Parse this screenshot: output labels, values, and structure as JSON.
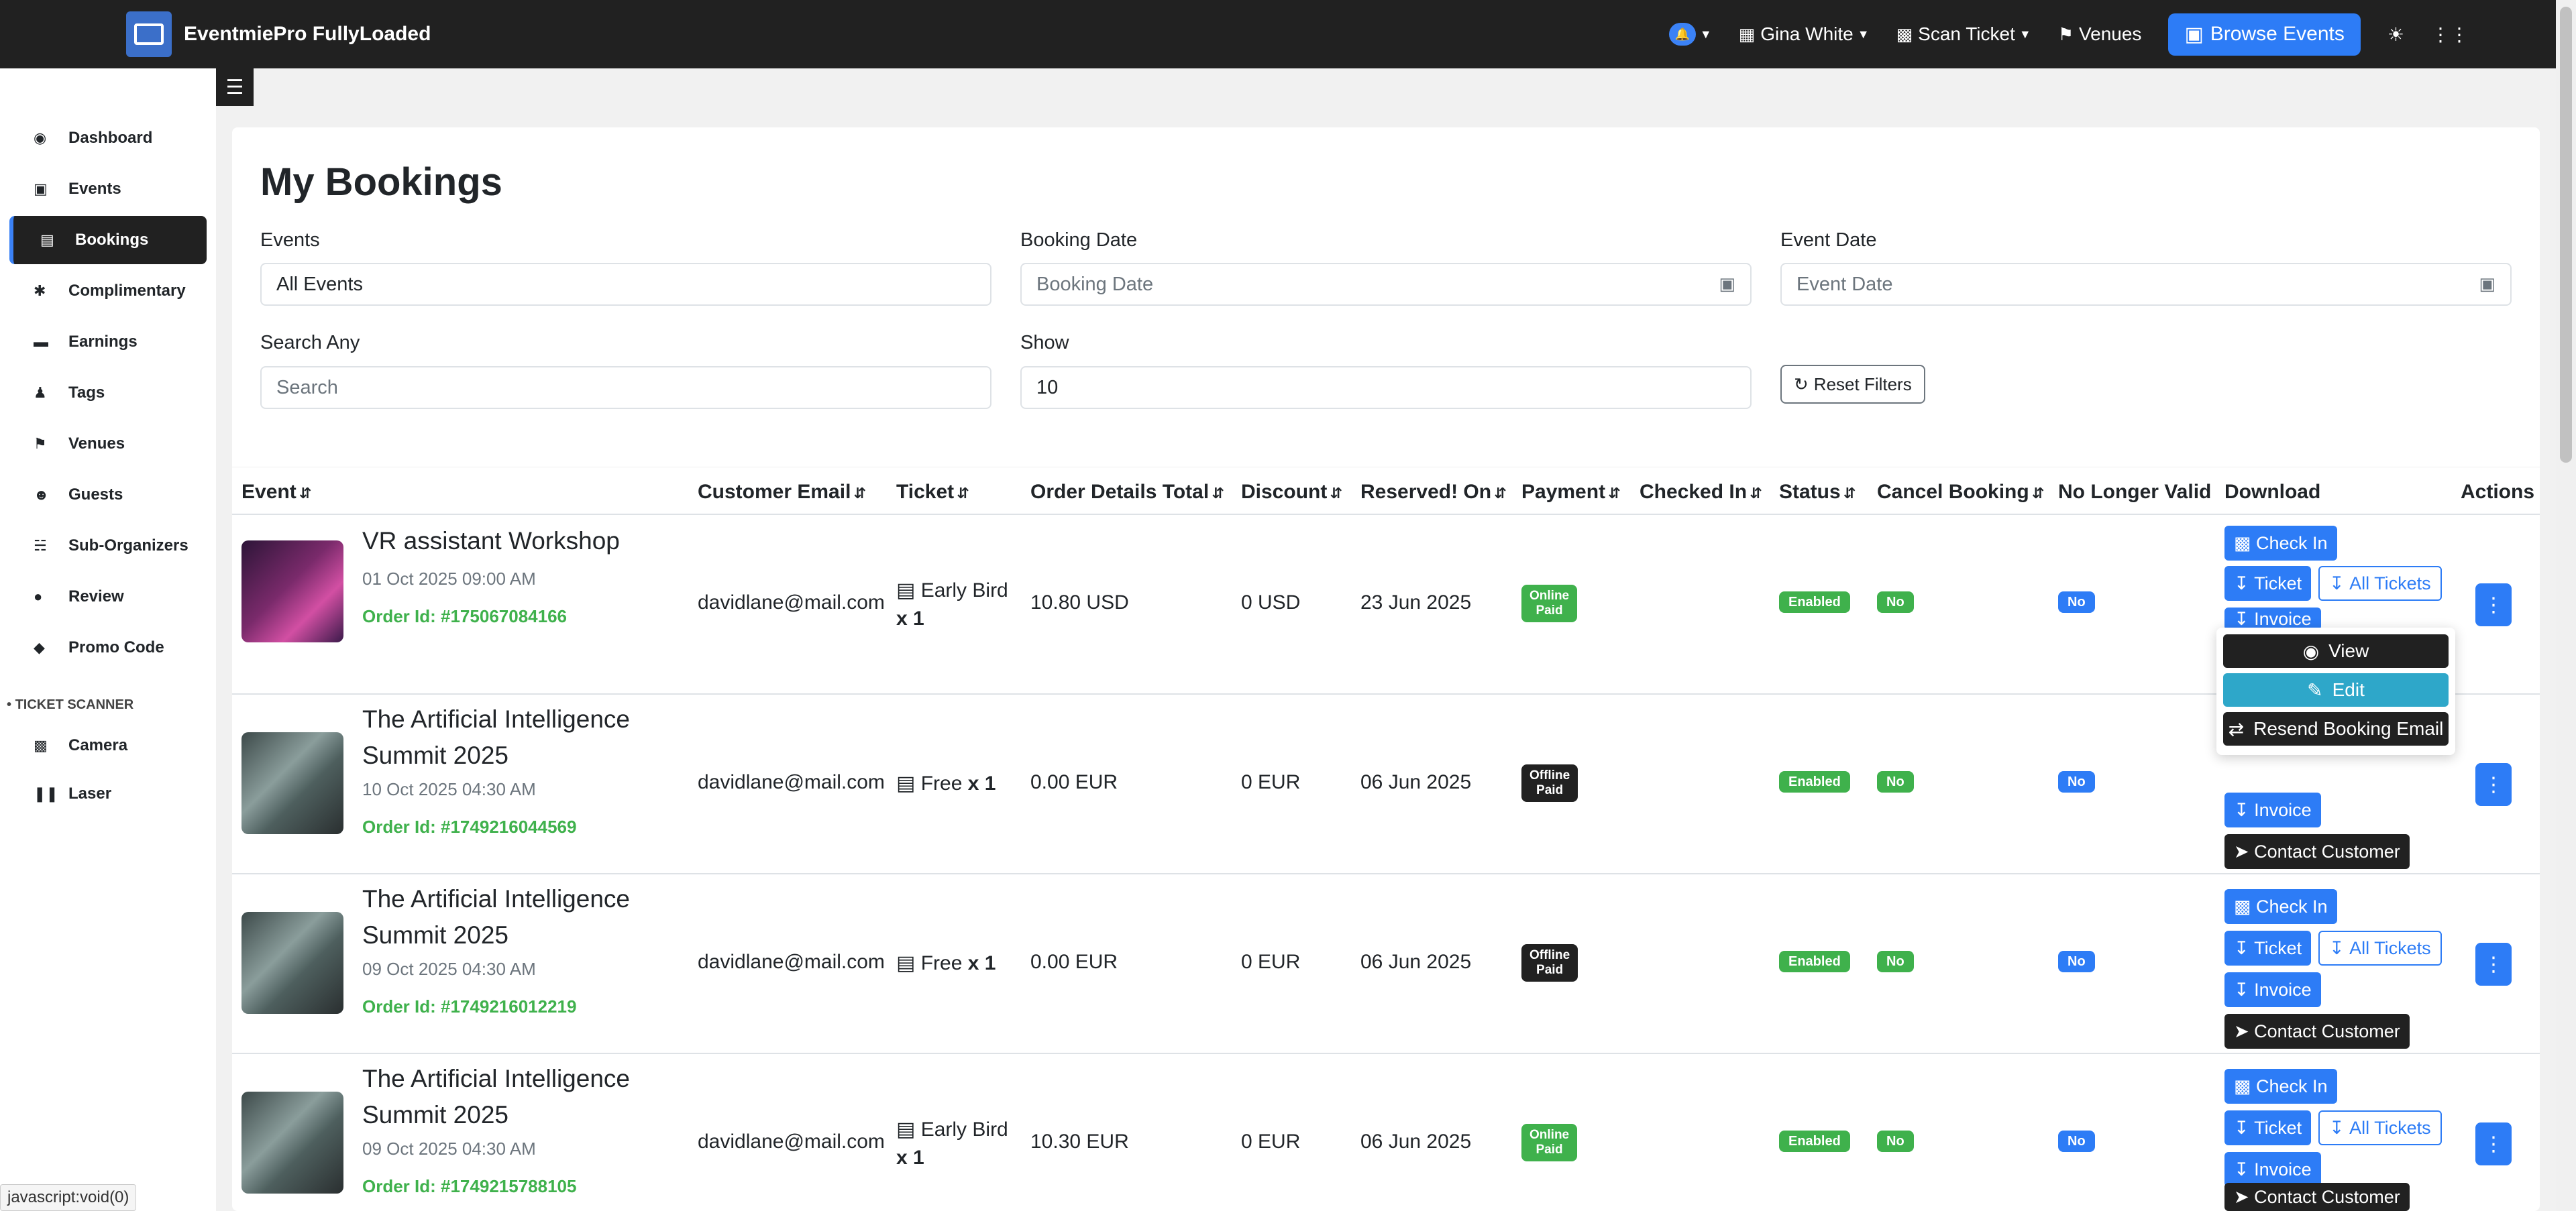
{
  "app": {
    "title": "EventmiePro FullyLoaded"
  },
  "topbar": {
    "user": "Gina White",
    "scan_ticket": "Scan Ticket",
    "venues": "Venues",
    "browse_events": "Browse Events"
  },
  "sidebar": {
    "items": [
      {
        "label": "Dashboard",
        "icon": "dashboard-icon"
      },
      {
        "label": "Events",
        "icon": "calendar-icon"
      },
      {
        "label": "Bookings",
        "icon": "ticket-icon",
        "active": true
      },
      {
        "label": "Complimentary",
        "icon": "puzzle-icon"
      },
      {
        "label": "Earnings",
        "icon": "wallet-icon"
      },
      {
        "label": "Tags",
        "icon": "user-tag-icon"
      },
      {
        "label": "Venues",
        "icon": "map-icon"
      },
      {
        "label": "Guests",
        "icon": "users-icon"
      },
      {
        "label": "Sub-Organizers",
        "icon": "sitemap-icon"
      },
      {
        "label": "Review",
        "icon": "comment-icon"
      },
      {
        "label": "Promo Code",
        "icon": "tag-icon"
      }
    ],
    "section": "TICKET SCANNER",
    "scanner_items": [
      {
        "label": "Camera",
        "icon": "qrcode-icon"
      },
      {
        "label": "Laser",
        "icon": "barcode-icon"
      }
    ]
  },
  "page": {
    "title": "My Bookings"
  },
  "filters": {
    "events_label": "Events",
    "events_value": "All Events",
    "booking_date_label": "Booking Date",
    "booking_date_placeholder": "Booking Date",
    "event_date_label": "Event Date",
    "event_date_placeholder": "Event Date",
    "search_label": "Search Any",
    "search_placeholder": "Search",
    "show_label": "Show",
    "show_value": "10",
    "reset_label": "Reset Filters"
  },
  "table": {
    "headers": [
      "Event",
      "Customer Email",
      "Ticket",
      "Order Details Total",
      "Discount",
      "Reserved! On",
      "Payment",
      "Checked In",
      "Status",
      "Cancel Booking",
      "No Longer Valid",
      "Download",
      "Actions"
    ],
    "rows": [
      {
        "title": "VR assistant Workshop",
        "date": "01 Oct 2025 09:00 AM",
        "order": "Order Id: #175067084166",
        "email": "davidlane@mail.com",
        "ticket_name": "Early Bird",
        "ticket_qty": "x 1",
        "total": "10.80 USD",
        "discount": "0 USD",
        "reserved": "23 Jun 2025",
        "payment_1": "Online",
        "payment_2": "Paid",
        "status": "Enabled",
        "cancel": "No",
        "no_longer_valid": "No"
      },
      {
        "title": "The Artificial Intelligence Summit 2025",
        "date": "10 Oct 2025 04:30 AM",
        "order": "Order Id: #1749216044569",
        "email": "davidlane@mail.com",
        "ticket_name": "Free",
        "ticket_qty": "x 1",
        "total": "0.00 EUR",
        "discount": "0 EUR",
        "reserved": "06 Jun 2025",
        "payment_1": "Offline",
        "payment_2": "Paid",
        "status": "Enabled",
        "cancel": "No",
        "no_longer_valid": "No"
      },
      {
        "title": "The Artificial Intelligence Summit 2025",
        "date": "09 Oct 2025 04:30 AM",
        "order": "Order Id: #1749216012219",
        "email": "davidlane@mail.com",
        "ticket_name": "Free",
        "ticket_qty": "x 1",
        "total": "0.00 EUR",
        "discount": "0 EUR",
        "reserved": "06 Jun 2025",
        "payment_1": "Offline",
        "payment_2": "Paid",
        "status": "Enabled",
        "cancel": "No",
        "no_longer_valid": "No"
      },
      {
        "title": "The Artificial Intelligence Summit 2025",
        "date": "09 Oct 2025 04:30 AM",
        "order": "Order Id: #1749215788105",
        "email": "davidlane@mail.com",
        "ticket_name": "Early Bird",
        "ticket_qty": "x 1",
        "total": "10.30 EUR",
        "discount": "0 EUR",
        "reserved": "06 Jun 2025",
        "payment_1": "Online",
        "payment_2": "Paid",
        "status": "Enabled",
        "cancel": "No",
        "no_longer_valid": "No"
      }
    ],
    "download": {
      "check_in": "Check In",
      "ticket": "Ticket",
      "all_tickets": "All Tickets",
      "invoice": "Invoice",
      "contact": "Contact Customer"
    }
  },
  "menu": {
    "view": "View",
    "edit": "Edit",
    "resend": "Resend Booking Email"
  },
  "status_bar": "javascript:void(0)",
  "colors": {
    "primary": "#2d7cf6",
    "success": "#3fb14c",
    "dark": "#212121",
    "info": "#2ea7c9"
  }
}
